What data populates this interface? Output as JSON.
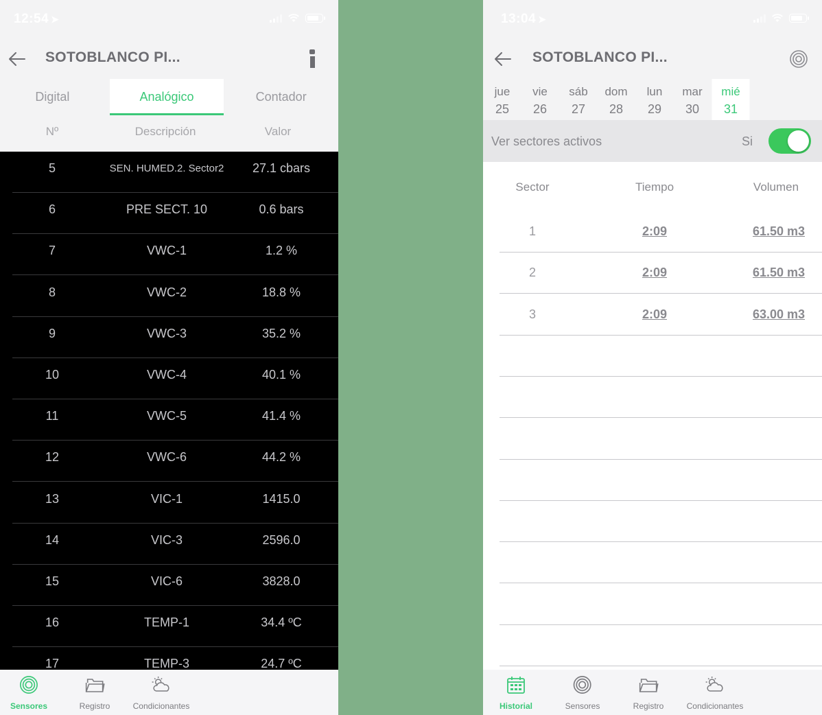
{
  "left": {
    "status": {
      "time": "12:54"
    },
    "title": "SOTOBLANCO PI...",
    "tabs": [
      "Digital",
      "Analógico",
      "Contador"
    ],
    "columns": [
      "Nº",
      "Descripción",
      "Valor"
    ],
    "rows": [
      {
        "n": "5",
        "desc": "SEN. HUMED.2. Sector2",
        "val": "27.1 cbars"
      },
      {
        "n": "6",
        "desc": "PRE SECT. 10",
        "val": "0.6 bars"
      },
      {
        "n": "7",
        "desc": "VWC-1",
        "val": "1.2 %"
      },
      {
        "n": "8",
        "desc": "VWC-2",
        "val": "18.8 %"
      },
      {
        "n": "9",
        "desc": "VWC-3",
        "val": "35.2 %"
      },
      {
        "n": "10",
        "desc": "VWC-4",
        "val": "40.1 %"
      },
      {
        "n": "11",
        "desc": "VWC-5",
        "val": "41.4 %"
      },
      {
        "n": "12",
        "desc": "VWC-6",
        "val": "44.2 %"
      },
      {
        "n": "13",
        "desc": "VIC-1",
        "val": "1415.0"
      },
      {
        "n": "14",
        "desc": "VIC-3",
        "val": "2596.0"
      },
      {
        "n": "15",
        "desc": "VIC-6",
        "val": "3828.0"
      },
      {
        "n": "16",
        "desc": "TEMP-1",
        "val": "34.4 ºC"
      },
      {
        "n": "17",
        "desc": "TEMP-3",
        "val": "24.7 ºC"
      }
    ],
    "tabbar": [
      "Sensores",
      "Registro",
      "Condicionantes"
    ]
  },
  "right": {
    "status": {
      "time": "13:04"
    },
    "title": "SOTOBLANCO PI...",
    "days": [
      {
        "name": "jue",
        "num": "25"
      },
      {
        "name": "vie",
        "num": "26"
      },
      {
        "name": "sáb",
        "num": "27"
      },
      {
        "name": "dom",
        "num": "28"
      },
      {
        "name": "lun",
        "num": "29"
      },
      {
        "name": "mar",
        "num": "30"
      },
      {
        "name": "mié",
        "num": "31"
      }
    ],
    "toggle": {
      "label": "Ver sectores activos",
      "value": "Si"
    },
    "columns": [
      "Sector",
      "Tiempo",
      "Volumen"
    ],
    "rows": [
      {
        "sector": "1",
        "time": "2:09",
        "volume": "61.50 m3"
      },
      {
        "sector": "2",
        "time": "2:09",
        "volume": "61.50 m3"
      },
      {
        "sector": "3",
        "time": "2:09",
        "volume": "63.00 m3"
      }
    ],
    "tabbar": [
      "Historial",
      "Sensores",
      "Registro",
      "Condicionantes"
    ]
  },
  "colors": {
    "accent": "#3bc878",
    "switch": "#3bc85c",
    "divider_bg": "#80b088"
  },
  "icons": [
    "back-arrow-icon",
    "info-icon",
    "target-icon",
    "sensor-icon",
    "folder-icon",
    "weather-icon",
    "calendar-icon",
    "location-arrow-icon",
    "signal-icon",
    "wifi-icon",
    "battery-icon"
  ]
}
